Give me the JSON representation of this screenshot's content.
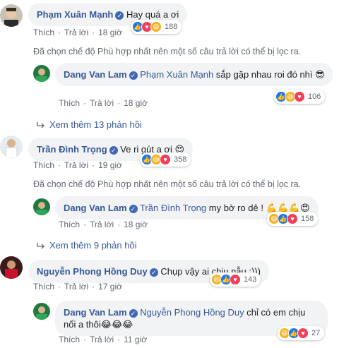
{
  "actions": {
    "like": "Thích",
    "reply": "Trả lời"
  },
  "filtered_notice": "Đã chọn chế độ Phù hợp nhất nên một số câu trả lời có thể bị lọc ra.",
  "comments": [
    {
      "author": "Phạm Xuân Mạnh",
      "text": "Hay quá a ơi",
      "time": "18 giờ",
      "reaction_count": "188",
      "reaction_icons": [
        "like-icon",
        "love-icon",
        "haha-icon"
      ]
    },
    {
      "author": "Dang Van Lam",
      "mention": "Phạm Xuân Mạnh",
      "text": "sắp gặp nhau roi đó nhì 😎",
      "time": "18 giờ",
      "reaction_count": "106",
      "reaction_icons": [
        "like-icon",
        "haha-icon",
        "love-icon"
      ]
    },
    {
      "more_replies": "Xem thêm 13 phản hồi"
    },
    {
      "author": "Trần Đình Trọng",
      "text": "Ve ri gút a ơi 😍",
      "time": "19 giờ",
      "reaction_count": "358",
      "reaction_icons": [
        "like-icon",
        "haha-icon",
        "love-icon"
      ]
    },
    {
      "author": "Dang Van Lam",
      "mention": "Trần Đình Trọng",
      "text": "my bờ ro dê ! 💪💪💪😍",
      "time": "18 giờ",
      "reaction_count": "158",
      "reaction_icons": [
        "haha-icon",
        "like-icon",
        "love-icon"
      ]
    },
    {
      "more_replies": "Xem thêm 9 phản hồi"
    },
    {
      "author": "Nguyễn Phong Hồng Duy",
      "text": "Chụp vậy ai chịu nẫu :)))",
      "time": "17 giờ",
      "reaction_count": "143",
      "reaction_icons": [
        "haha-icon",
        "like-icon",
        "love-icon"
      ]
    },
    {
      "author": "Dang Van Lam",
      "mention": "Nguyễn Phong Hồng Duy",
      "text": "chỉ có em chịu nổi a thôi😂😂😂",
      "time": "11 giờ",
      "reaction_count": "27",
      "reaction_icons": [
        "haha-icon",
        "like-icon",
        "love-icon"
      ]
    }
  ],
  "colors": {
    "author": "#385898",
    "bubble": "#f2f3f5",
    "meta": "#606770",
    "like": "#1877f2",
    "love": "#f33e58",
    "haha": "#f7b125"
  }
}
